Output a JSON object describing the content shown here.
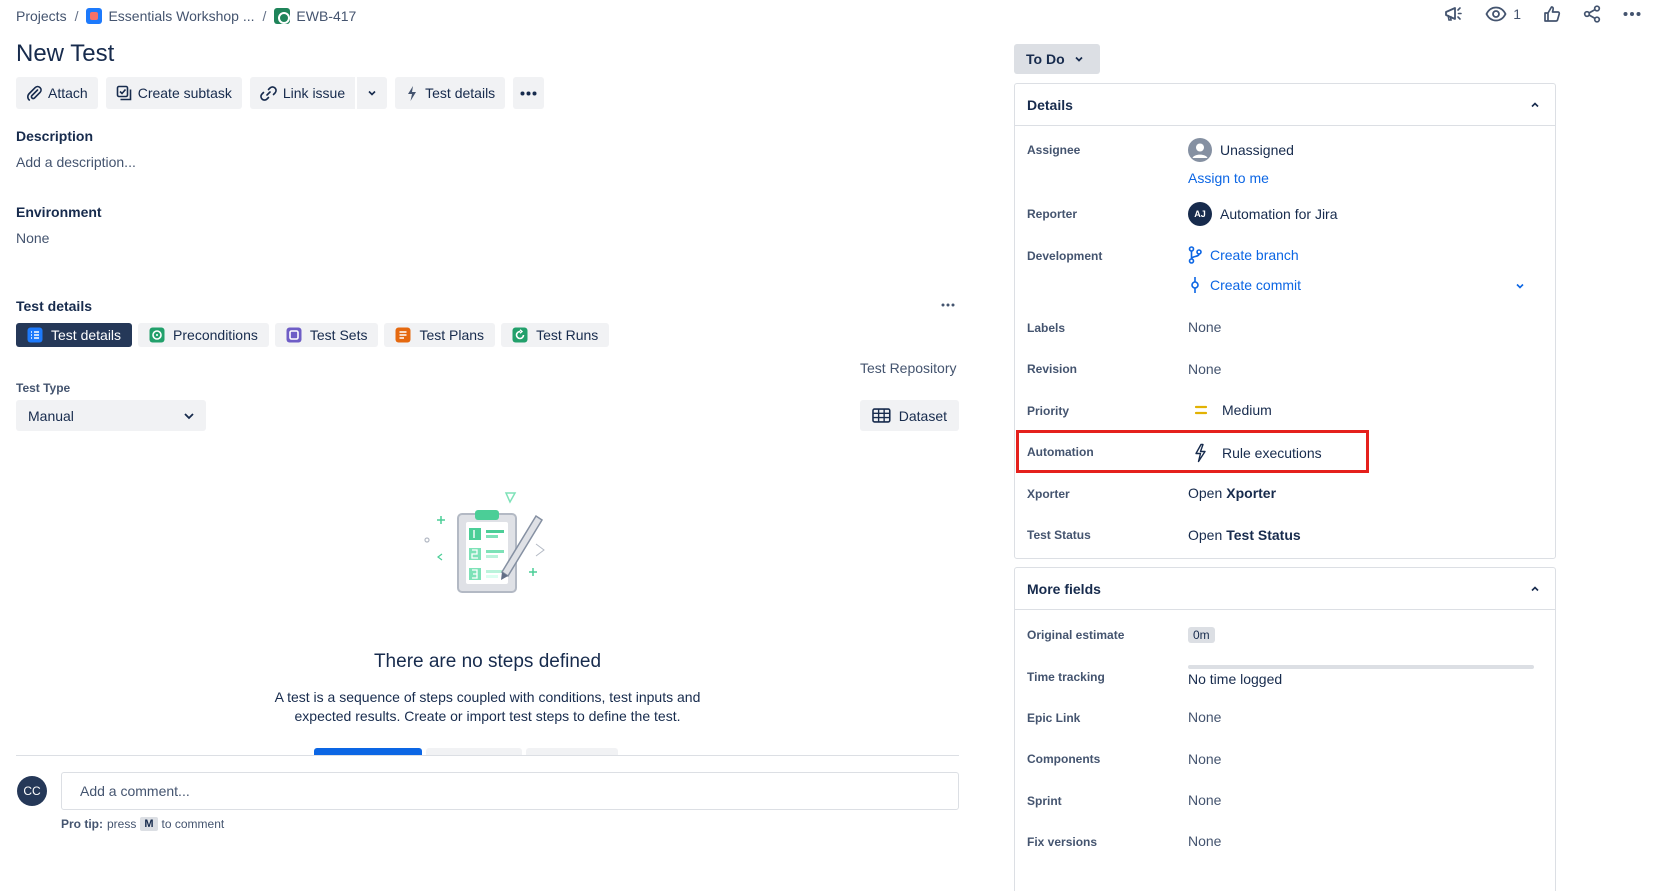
{
  "breadcrumb": {
    "projects": "Projects",
    "sep": "/",
    "project": "Essentials Workshop ...",
    "issue_key": "EWB-417"
  },
  "top_actions": {
    "watch_count": "1"
  },
  "title": "New Test",
  "toolbar": {
    "attach": "Attach",
    "create_subtask": "Create subtask",
    "link_issue": "Link issue",
    "test_details": "Test details"
  },
  "description": {
    "label": "Description",
    "placeholder": "Add a description..."
  },
  "environment": {
    "label": "Environment",
    "value": "None"
  },
  "test_details_section": {
    "label": "Test details",
    "tabs": [
      {
        "label": "Test details",
        "color": "#1d7afc"
      },
      {
        "label": "Preconditions",
        "color": "#22a06b"
      },
      {
        "label": "Test Sets",
        "color": "#6e5dc6"
      },
      {
        "label": "Test Plans",
        "color": "#e56910"
      },
      {
        "label": "Test Runs",
        "color": "#22a06b"
      }
    ],
    "repository_link": "Test Repository",
    "test_type_label": "Test Type",
    "test_type_value": "Manual",
    "dataset": "Dataset"
  },
  "empty_state": {
    "title": "There are no steps defined",
    "description": "A test is a sequence of steps coupled with conditions, test inputs and expected results. Create or import test steps to define the test."
  },
  "comment": {
    "avatar_initials": "CC",
    "placeholder": "Add a comment...",
    "protip_prefix": "Pro tip:",
    "protip_press": "press",
    "protip_key": "M",
    "protip_suffix": "to comment"
  },
  "status": {
    "label": "To Do"
  },
  "details": {
    "title": "Details",
    "assignee_label": "Assignee",
    "assignee_value": "Unassigned",
    "assign_to_me": "Assign to me",
    "reporter_label": "Reporter",
    "reporter_initials": "AJ",
    "reporter_value": "Automation for Jira",
    "development_label": "Development",
    "create_branch": "Create branch",
    "create_commit": "Create commit",
    "labels_label": "Labels",
    "labels_value": "None",
    "revision_label": "Revision",
    "revision_value": "None",
    "priority_label": "Priority",
    "priority_value": "Medium",
    "automation_label": "Automation",
    "automation_value": "Rule executions",
    "xporter_label": "Xporter",
    "xporter_open": "Open",
    "xporter_name": "Xporter",
    "test_status_label": "Test Status",
    "test_status_open": "Open",
    "test_status_name": "Test Status"
  },
  "more_fields": {
    "title": "More fields",
    "original_estimate_label": "Original estimate",
    "original_estimate_value": "0m",
    "time_tracking_label": "Time tracking",
    "time_tracking_value": "No time logged",
    "epic_link_label": "Epic Link",
    "epic_link_value": "None",
    "components_label": "Components",
    "components_value": "None",
    "sprint_label": "Sprint",
    "sprint_value": "None",
    "fix_versions_label": "Fix versions",
    "fix_versions_value": "None"
  },
  "colors": {
    "primary_text": "#172b4d",
    "link": "#0c66e4",
    "highlight": "#e5201c",
    "active_tab": "#253858",
    "priority_medium": "#e2b203"
  }
}
